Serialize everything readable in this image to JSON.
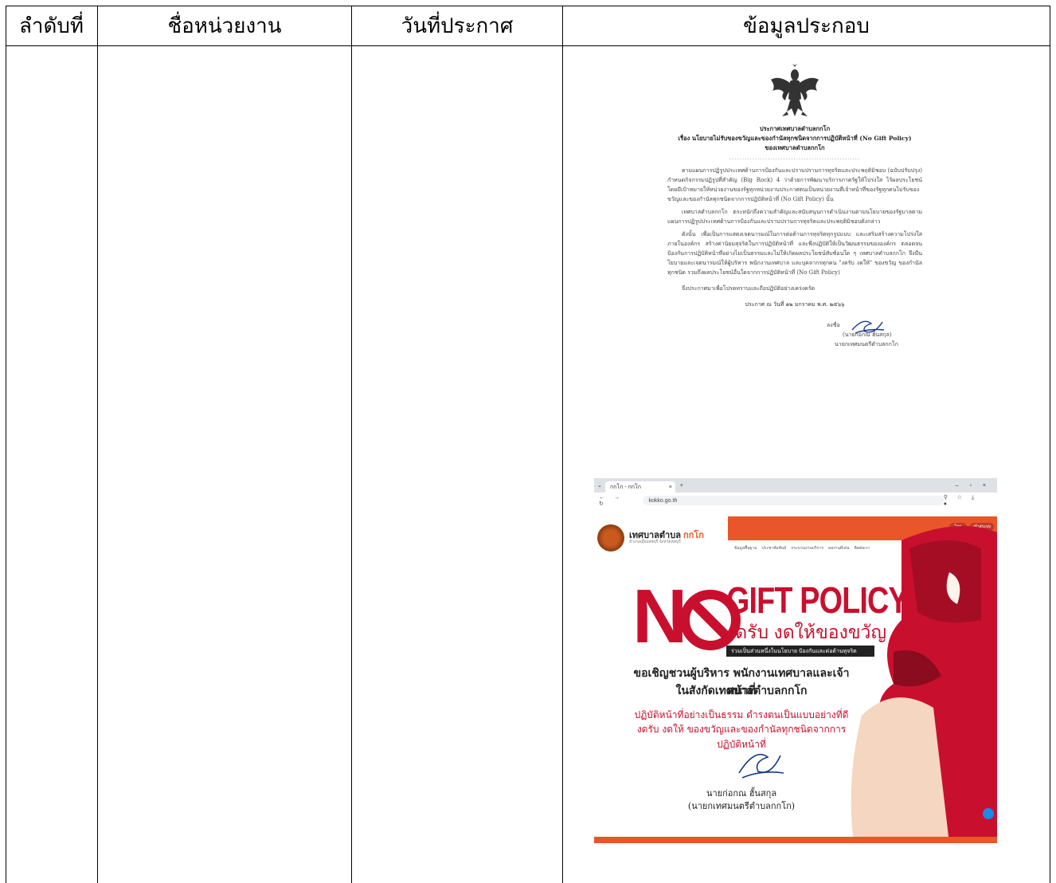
{
  "table": {
    "headers": [
      "ลำดับที่",
      "ชื่อหน่วยงาน",
      "วันที่ประกาศ",
      "ข้อมูลประกอบ"
    ]
  },
  "announcement": {
    "title": "ประกาศเทศบาลตำบลกกโก",
    "subject": "เรื่อง  นโยบายไม่รับของขวัญและของกำนัลทุกชนิดจากการปฏิบัติหน้าที่ (No Gift Policy)",
    "subject2": "ของเทศบาลตำบลกกโก",
    "separator": "...................................................",
    "para1": "ตามแผนการปฏิรูปประเทศด้านการป้องกันและปราบปรามการทุจริตและประพฤติมิชอบ (ฉบับปรับปรุง) กำหนดกิจกรรมปฏิรูปที่สำคัญ (Big Rock) 4 ว่าด้วยการพัฒนาบริการภาครัฐให้โปร่งใส ไร้ผลประโยชน์ โดยมีเป้าหมายให้หน่วยงานของรัฐทุกหน่วยงานประกาศตนเป็นหน่วยงานที่เจ้าหน้าที่ของรัฐทุกคนไม่รับของขวัญและของกำนัลทุกชนิดจากการปฏิบัติหน้าที่ (No Gift Policy) นั้น",
    "para2": "เทศบาลตำบลกกโก ตระหนักถึงความสำคัญและสนับสนุนการดำเนินงานตามนโยบายของรัฐบาลตามแผนการปฏิรูปประเทศด้านการป้องกันและปราบปรามการทุจริตและประพฤติมิชอบดังกล่าว",
    "para3": "ดังนั้น เพื่อเป็นการแสดงเจตนารมณ์ในการต่อต้านการทุจริตทุกรูปแบบ และเสริมสร้างความโปร่งใสภายในองค์กร สร้างค่านิยมสุจริตในการปฏิบัติหน้าที่ และพึงปฏิบัติให้เป็นวัฒนธรรมขององค์กร ตลอดจนป้องกันการปฏิบัติหน้าที่อย่างไม่เป็นธรรมและไม่ให้เกิดผลประโยชน์ทับซ้อนใด ๆ เทศบาลตำบลกกโก จึงมีนโยบายและเจตนารมณ์ให้ผู้บริหาร พนักงานเทศบาล และบุคลากรทุกคน \"งดรับ งดให้\" ของขวัญ ของกำนัลทุกชนิด รวมถึงผลประโยชน์อื่นใดจากการปฏิบัติหน้าที่ (No Gift Policy)",
    "para4": "จึงประกาศมาเพื่อโปรดทราบและถือปฏิบัติอย่างเคร่งครัด",
    "date": "ประกาศ ณ วันที่  ๑๒  มกราคม  พ.ศ. ๒๕๖๖",
    "sign_label": "ลงชื่อ",
    "signer": "(นายก่อกณ  ฮั้นสกุล)",
    "position": "นายกเทศมนตรีตำบลกกโก"
  },
  "screenshot": {
    "tab_title": "กกโก - กกโก",
    "url": "kokko.go.th",
    "brand": "เทศบาลตำบล",
    "brand_accent": "กกโก",
    "brand_sub": "อำเภอเมืองลพบุรี จังหวัดลพบุรี",
    "lang_button": "ไทย",
    "login_button": "เข้าสู่ระบบ",
    "menu": [
      "ข้อมูลพื้นฐาน",
      "ประชาสัมพันธ์",
      "กระบวนงานบริการ",
      "ผลงานดีเด่น",
      "ติดต่อเรา"
    ],
    "no": "N",
    "gift_policy": "GIFT POLICY",
    "sub": "งดรับ งดให้ของขวัญ",
    "black_strip": "ร่วมเป็นส่วนหนึ่งในนโยบาย ป้องกันและต่อต้านทุจริต",
    "invite1": "ขอเชิญชวนผู้บริหาร พนักงานเทศบาลและเจ้าหน้าที่",
    "invite2": "ในสังกัดเทศบาลตำบลกกโก",
    "red1": "ปฏิบัติหน้าที่อย่างเป็นธรรม ดำรงตนเป็นแบบอย่างที่ดี",
    "red2": "งดรับ งดให้ ของขวัญและของกำนัลทุกชนิดจากการปฏิบัติหน้าที่",
    "name": "นายก่อกณ  ฮั้นสกุล",
    "name_pos": "(นายกเทศมนตรีตำบลกกโก)"
  }
}
